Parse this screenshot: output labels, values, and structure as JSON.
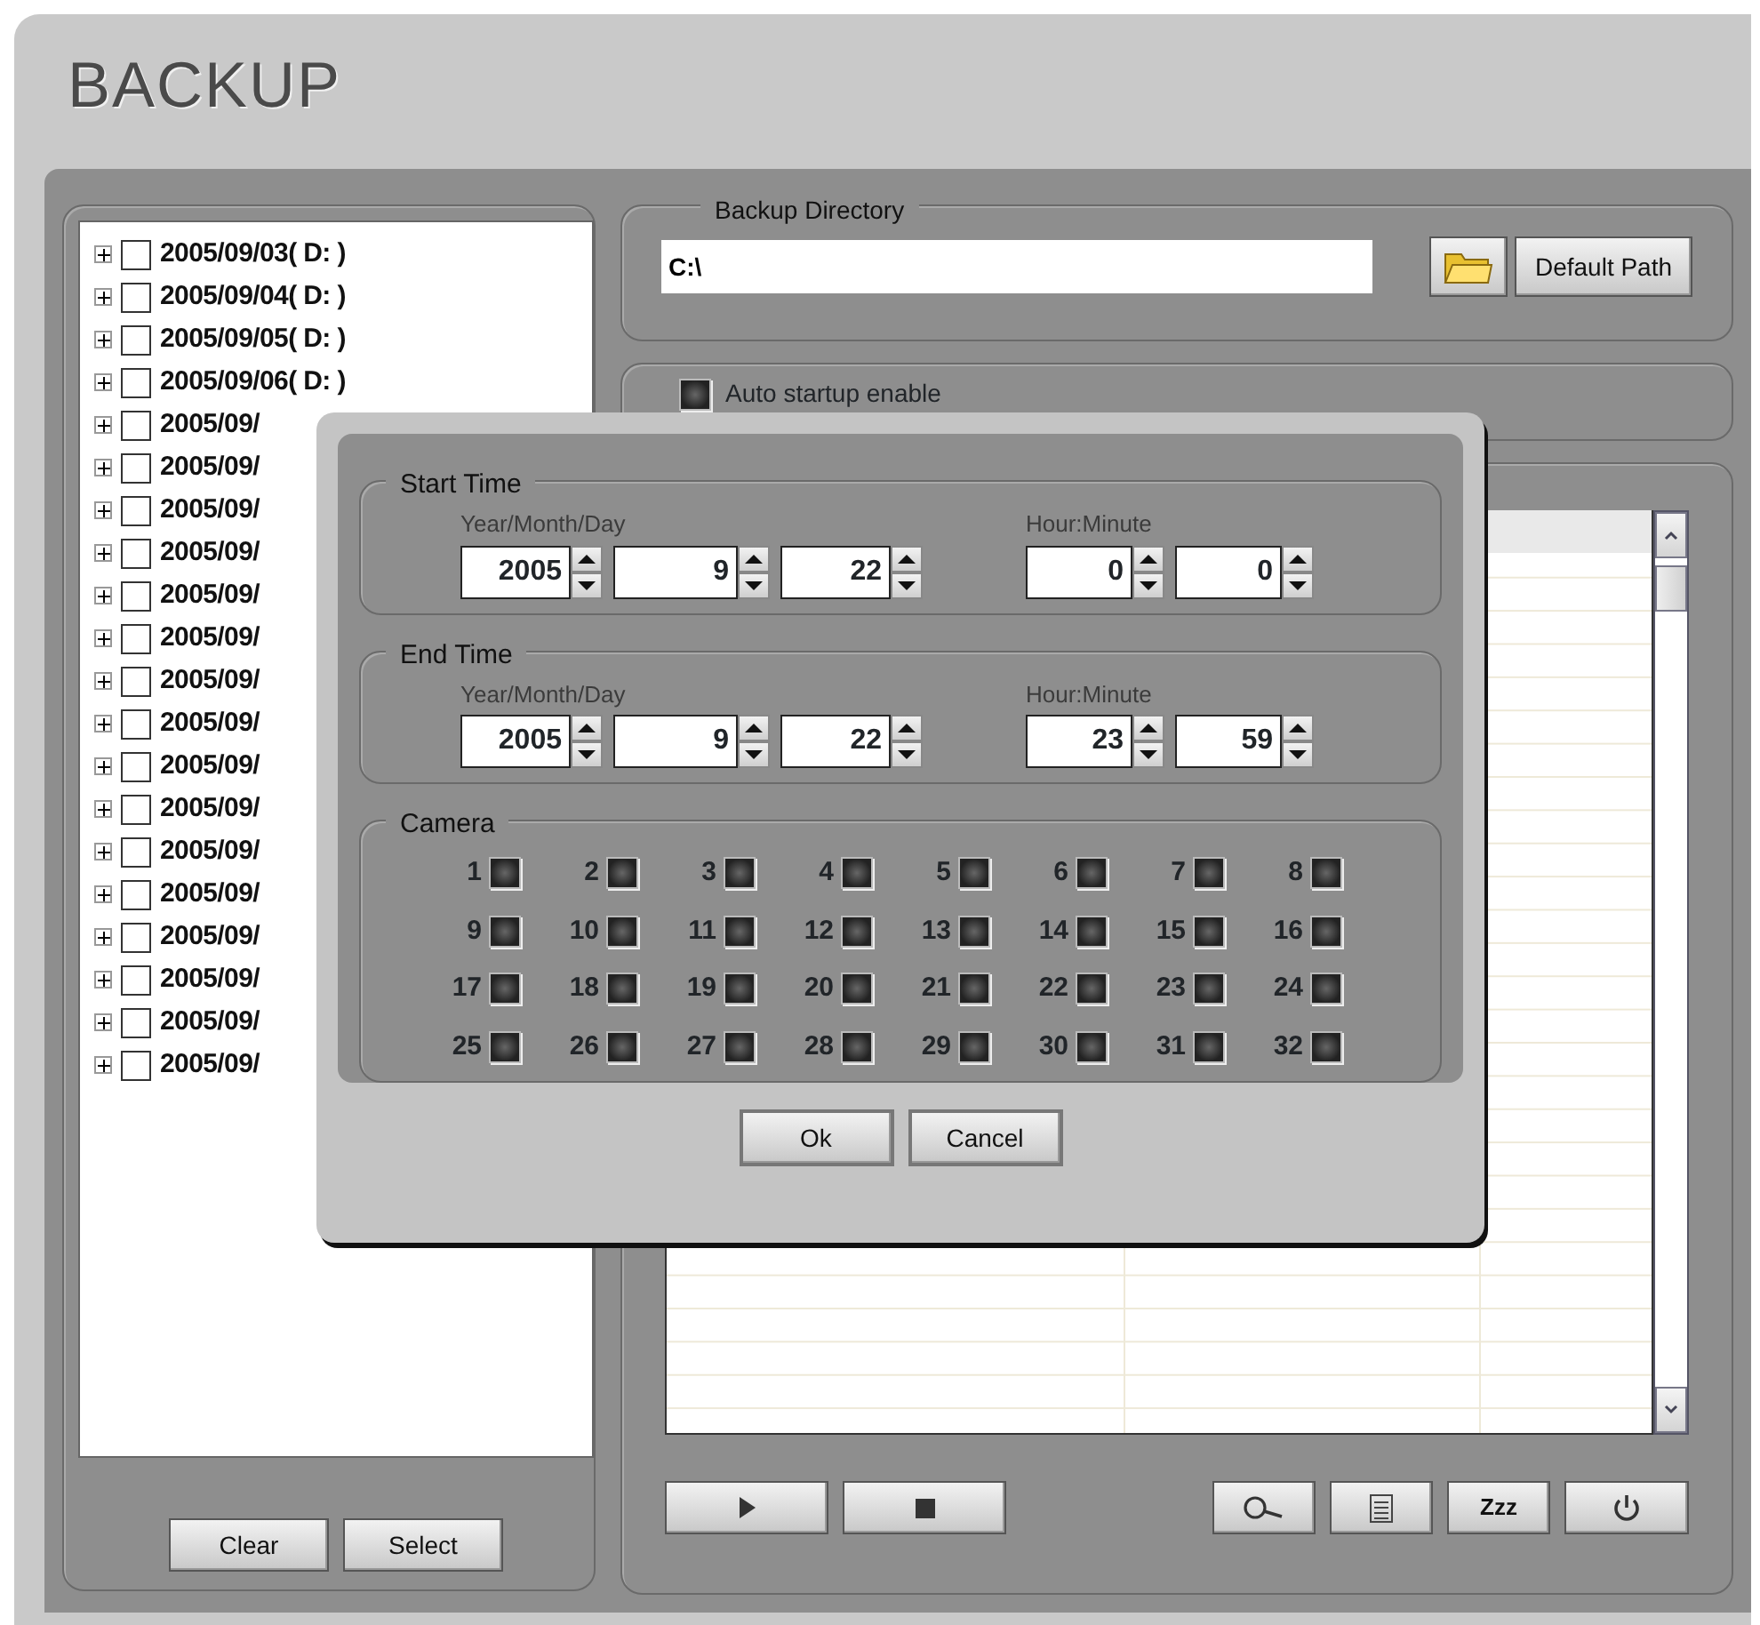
{
  "window": {
    "title": "BACKUP"
  },
  "tree": {
    "items": [
      {
        "label": "2005/09/03( D: )",
        "checked": false,
        "expanded": false
      },
      {
        "label": "2005/09/04( D: )",
        "checked": false,
        "expanded": false
      },
      {
        "label": "2005/09/05( D: )",
        "checked": false,
        "expanded": false
      },
      {
        "label": "2005/09/06( D: )",
        "checked": false,
        "expanded": false
      },
      {
        "label": "2005/09/",
        "checked": false,
        "expanded": false
      },
      {
        "label": "2005/09/",
        "checked": false,
        "expanded": false
      },
      {
        "label": "2005/09/",
        "checked": false,
        "expanded": false
      },
      {
        "label": "2005/09/",
        "checked": false,
        "expanded": false
      },
      {
        "label": "2005/09/",
        "checked": false,
        "expanded": false
      },
      {
        "label": "2005/09/",
        "checked": false,
        "expanded": false
      },
      {
        "label": "2005/09/",
        "checked": false,
        "expanded": false
      },
      {
        "label": "2005/09/",
        "checked": false,
        "expanded": false
      },
      {
        "label": "2005/09/",
        "checked": false,
        "expanded": false
      },
      {
        "label": "2005/09/",
        "checked": false,
        "expanded": false
      },
      {
        "label": "2005/09/",
        "checked": false,
        "expanded": false
      },
      {
        "label": "2005/09/",
        "checked": false,
        "expanded": false
      },
      {
        "label": "2005/09/",
        "checked": false,
        "expanded": false
      },
      {
        "label": "2005/09/",
        "checked": false,
        "expanded": false
      },
      {
        "label": "2005/09/",
        "checked": false,
        "expanded": false
      },
      {
        "label": "2005/09/",
        "checked": false,
        "expanded": false
      }
    ],
    "buttons": [
      "Clear",
      "Select"
    ]
  },
  "backup_directory": {
    "title": "Backup Directory",
    "path": "C:\\",
    "button": "Default Path"
  },
  "auto_startup": {
    "label": "Auto startup enable",
    "checked": false
  },
  "playback_buttons": [
    {
      "kind": "play"
    },
    {
      "kind": "stop"
    }
  ],
  "tool_buttons": [
    {
      "kind": "search"
    },
    {
      "kind": "list"
    },
    {
      "kind": "text",
      "label": "Zzz"
    },
    {
      "kind": "power"
    }
  ],
  "dialog": {
    "time_groups": [
      {
        "title": "Start Time",
        "date_label": "Year/Month/Day",
        "time_label": "Hour:Minute",
        "date": [
          "2005",
          "9",
          "22"
        ],
        "time": [
          "0",
          "0"
        ]
      },
      {
        "title": "End Time",
        "date_label": "Year/Month/Day",
        "time_label": "Hour:Minute",
        "date": [
          "2005",
          "9",
          "22"
        ],
        "time": [
          "23",
          "59"
        ]
      }
    ],
    "camera": {
      "title": "Camera",
      "cameras": [
        {
          "label": "1",
          "checked": false
        },
        {
          "label": "2",
          "checked": false
        },
        {
          "label": "3",
          "checked": false
        },
        {
          "label": "4",
          "checked": false
        },
        {
          "label": "5",
          "checked": false
        },
        {
          "label": "6",
          "checked": false
        },
        {
          "label": "7",
          "checked": false
        },
        {
          "label": "8",
          "checked": false
        },
        {
          "label": "9",
          "checked": false
        },
        {
          "label": "10",
          "checked": false
        },
        {
          "label": "11",
          "checked": false
        },
        {
          "label": "12",
          "checked": false
        },
        {
          "label": "13",
          "checked": false
        },
        {
          "label": "14",
          "checked": false
        },
        {
          "label": "15",
          "checked": false
        },
        {
          "label": "16",
          "checked": false
        },
        {
          "label": "17",
          "checked": false
        },
        {
          "label": "18",
          "checked": false
        },
        {
          "label": "19",
          "checked": false
        },
        {
          "label": "20",
          "checked": false
        },
        {
          "label": "21",
          "checked": false
        },
        {
          "label": "22",
          "checked": false
        },
        {
          "label": "23",
          "checked": false
        },
        {
          "label": "24",
          "checked": false
        },
        {
          "label": "25",
          "checked": false
        },
        {
          "label": "26",
          "checked": false
        },
        {
          "label": "27",
          "checked": false
        },
        {
          "label": "28",
          "checked": false
        },
        {
          "label": "29",
          "checked": false
        },
        {
          "label": "30",
          "checked": false
        },
        {
          "label": "31",
          "checked": false
        },
        {
          "label": "32",
          "checked": false
        }
      ]
    },
    "buttons": [
      "Ok",
      "Cancel"
    ]
  }
}
